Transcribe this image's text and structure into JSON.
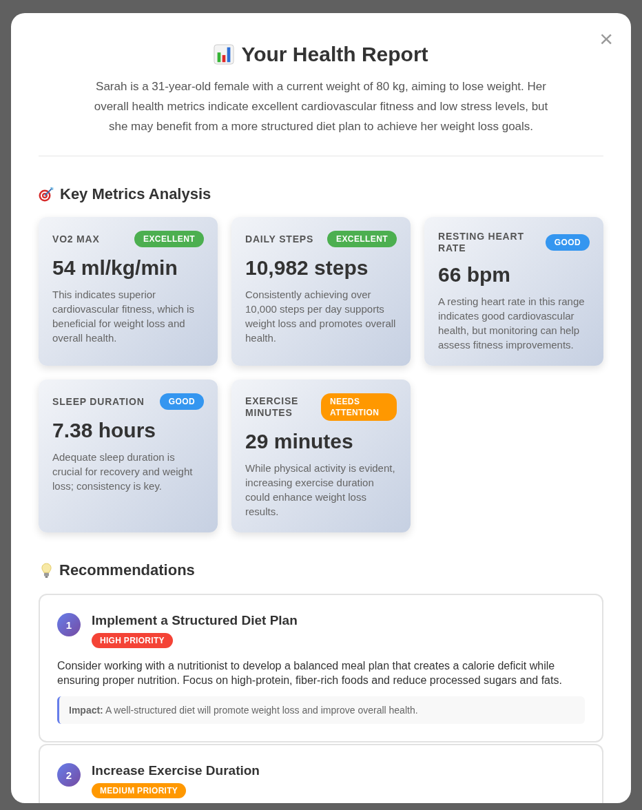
{
  "modal": {
    "title": "Your Health Report",
    "close": "×",
    "summary": "Sarah is a 31-year-old female with a current weight of 80 kg, aiming to lose weight. Her overall health metrics indicate excellent cardiovascular fitness and low stress levels, but she may benefit from a more structured diet plan to achieve her weight loss goals."
  },
  "metrics_section": {
    "heading": "Key Metrics Analysis",
    "metrics": [
      {
        "label": "VO2 MAX",
        "badge": {
          "text": "EXCELLENT",
          "color": "#4caf50"
        },
        "value": "54 ml/kg/min",
        "description": "This indicates superior cardiovascular fitness, which is beneficial for weight loss and overall health."
      },
      {
        "label": "DAILY STEPS",
        "badge": {
          "text": "EXCELLENT",
          "color": "#4caf50"
        },
        "value": "10,982 steps",
        "description": "Consistently achieving over 10,000 steps per day supports weight loss and promotes overall health."
      },
      {
        "label": "RESTING HEART RATE",
        "badge": {
          "text": "GOOD",
          "color": "#3496f0"
        },
        "value": "66 bpm",
        "description": "A resting heart rate in this range indicates good cardiovascular health, but monitoring can help assess fitness improvements."
      },
      {
        "label": "SLEEP DURATION",
        "badge": {
          "text": "GOOD",
          "color": "#3496f0"
        },
        "value": "7.38 hours",
        "description": "Adequate sleep duration is crucial for recovery and weight loss; consistency is key."
      },
      {
        "label": "EXERCISE MINUTES",
        "badge": {
          "text": "NEEDS ATTENTION",
          "color": "#ff9800"
        },
        "value": "29 minutes",
        "description": "While physical activity is evident, increasing exercise duration could enhance weight loss results."
      }
    ]
  },
  "recommendations_section": {
    "heading": "Recommendations",
    "items": [
      {
        "number": "1",
        "title": "Implement a Structured Diet Plan",
        "priority": {
          "text": "HIGH PRIORITY",
          "color": "#f44336"
        },
        "description": "Consider working with a nutritionist to develop a balanced meal plan that creates a calorie deficit while ensuring proper nutrition. Focus on high-protein, fiber-rich foods and reduce processed sugars and fats.",
        "impact": "**Impact:** A well-structured diet will promote weight loss and improve overall health."
      },
      {
        "number": "2",
        "title": "Increase Exercise Duration",
        "priority": {
          "text": "MEDIUM PRIORITY",
          "color": "#ff9800"
        }
      }
    ]
  }
}
